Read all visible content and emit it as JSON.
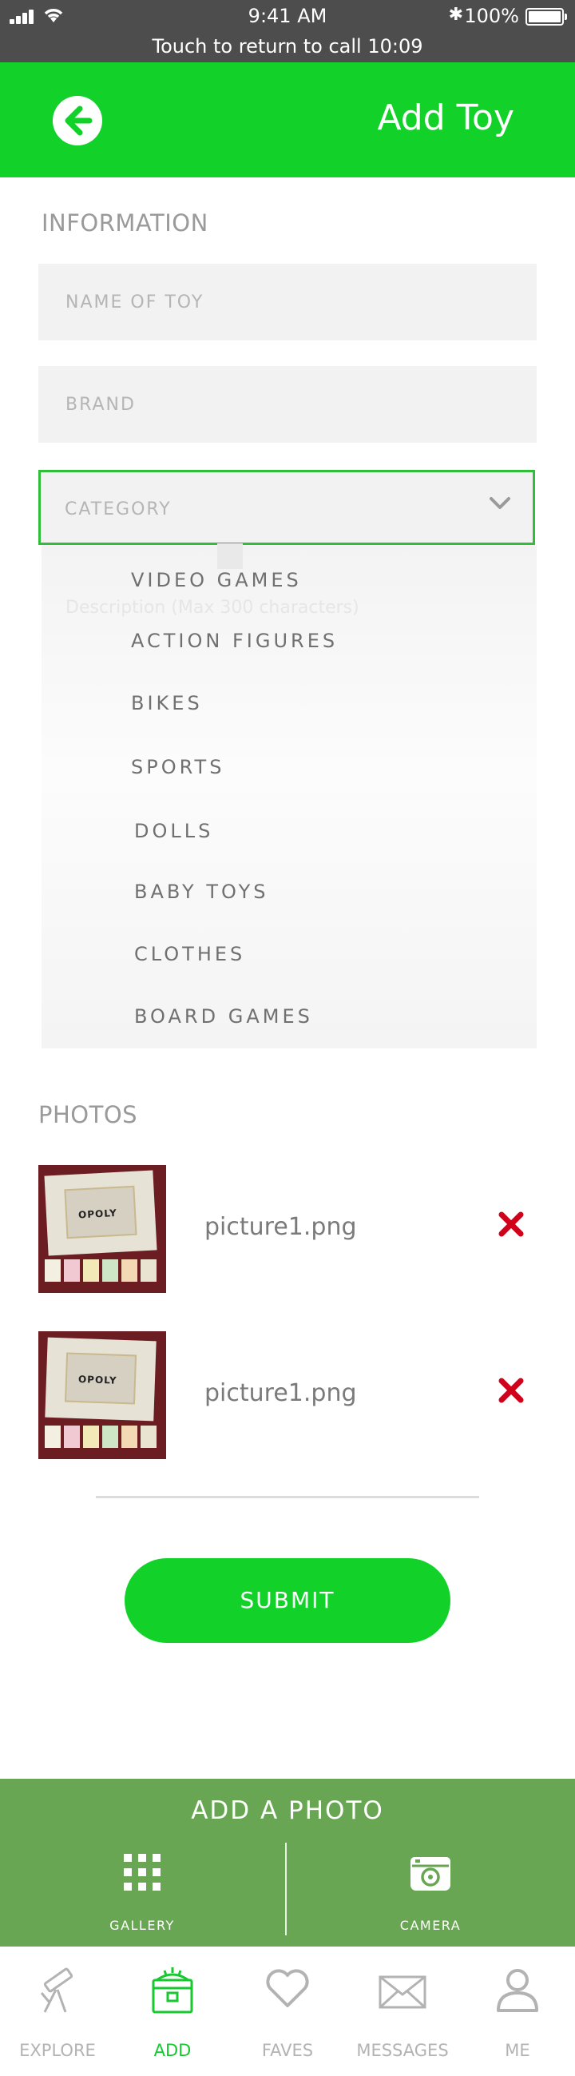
{
  "status_bar": {
    "time": "9:41 AM",
    "call_banner": "Touch to return to call 10:09",
    "battery": "100%"
  },
  "header": {
    "title": "Add Toy"
  },
  "form": {
    "section_label": "INFORMATION",
    "name_placeholder": "NAME OF TOY",
    "brand_placeholder": "BRAND",
    "category_placeholder": "CATEGORY",
    "underlying_hint": "Description (Max 300 characters)"
  },
  "category_options": [
    "VIDEO GAMES",
    "ACTION FIGURES",
    "BIKES",
    "SPORTS",
    "DOLLS",
    "BABY TOYS",
    "CLOTHES",
    "BOARD GAMES"
  ],
  "photos": {
    "section_label": "PHOTOS",
    "items": [
      {
        "file_name": "picture1.png",
        "board_text": "OPOLY"
      },
      {
        "file_name": "picture1.png",
        "board_text": "OPOLY"
      }
    ]
  },
  "submit_label": "SUBMIT",
  "add_photo": {
    "title": "ADD A PHOTO",
    "gallery_label": "GALLERY",
    "camera_label": "CAMERA"
  },
  "tabs": [
    {
      "label": "EXPLORE",
      "icon": "telescope-icon",
      "active": false
    },
    {
      "label": "ADD",
      "icon": "toy-chest-icon",
      "active": true
    },
    {
      "label": "FAVES",
      "icon": "heart-icon",
      "active": false
    },
    {
      "label": "MESSAGES",
      "icon": "envelope-icon",
      "active": false
    },
    {
      "label": "ME",
      "icon": "user-icon",
      "active": false
    }
  ],
  "colors": {
    "brand_green": "#12d22a",
    "panel_green": "#68a653",
    "focus_border": "#2fbf3a",
    "remove_red": "#d0021b"
  }
}
